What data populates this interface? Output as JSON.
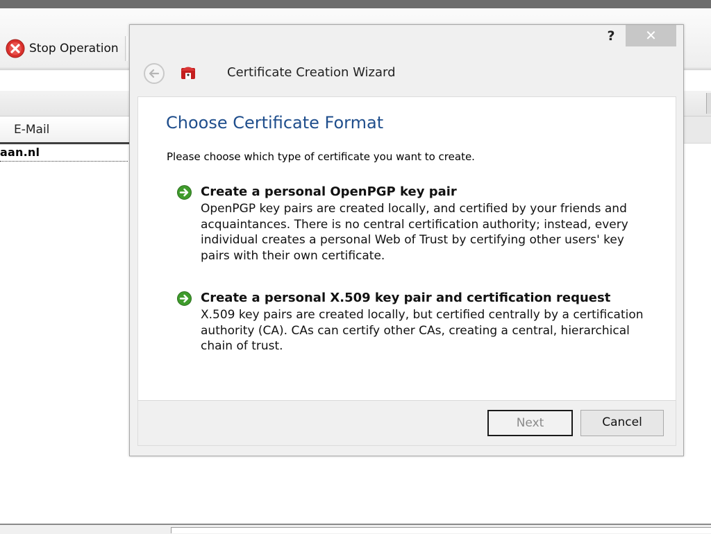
{
  "app": {
    "toolbar": {
      "stop_label": "Stop Operation"
    },
    "list": {
      "column_email": "E-Mail",
      "rows": [
        "aan.nl"
      ]
    }
  },
  "dialog": {
    "title": "Certificate Creation Wizard",
    "help": "?",
    "close": "✕",
    "heading": "Choose Certificate Format",
    "description": "Please choose which type of certificate you want to create.",
    "options": [
      {
        "title": "Create a personal OpenPGP key pair",
        "description": "OpenPGP key pairs are created locally, and certified by your friends and acquaintances. There is no central certification authority; instead, every individual creates a personal Web of Trust by certifying other users' key pairs with their own certificate."
      },
      {
        "title": "Create a personal X.509 key pair and certification request",
        "description": "X.509 key pairs are created locally, but certified centrally by a certification authority (CA). CAs can certify other CAs, creating a central, hierarchical chain of trust."
      }
    ],
    "buttons": {
      "next": "Next",
      "cancel": "Cancel"
    }
  },
  "colors": {
    "heading": "#1f4e8c",
    "arrow_green": "#3f9b2c",
    "stop_red": "#d9302c"
  }
}
